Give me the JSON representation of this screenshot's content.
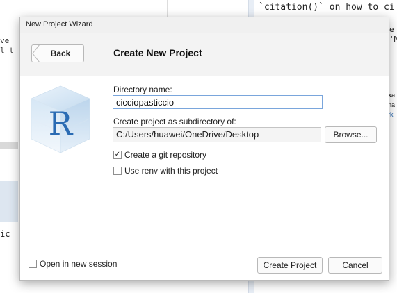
{
  "background": {
    "code_top": "`citation()` on how to ci",
    "right_line1": "e",
    "right_line2": "'M",
    "left_line1": "ve",
    "left_line2": "l t",
    "left_line3": "ic",
    "side_lines": [
      "ka",
      "na",
      "rk"
    ]
  },
  "dialog": {
    "title": "New Project Wizard",
    "back_label": "Back",
    "header_title": "Create New Project",
    "directory_label": "Directory name:",
    "directory_value": "cicciopasticcio",
    "subdir_label": "Create project as subdirectory of:",
    "subdir_value": "C:/Users/huawei/OneDrive/Desktop",
    "browse_label": "Browse...",
    "git_label": "Create a git repository",
    "git_checked": true,
    "renv_label": "Use renv with this project",
    "renv_checked": false,
    "new_session_label": "Open in new session",
    "new_session_checked": false,
    "create_label": "Create Project",
    "cancel_label": "Cancel",
    "logo_letter": "R"
  },
  "colors": {
    "r_logo_blue": "#2a6bb3",
    "input_focus_border": "#7aa6dc"
  }
}
